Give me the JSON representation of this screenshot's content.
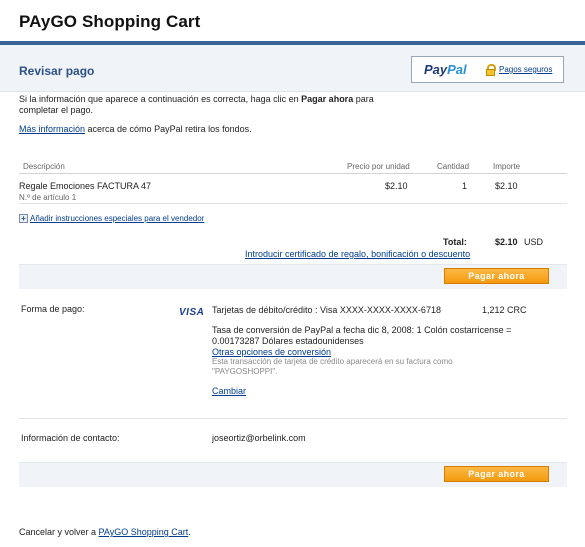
{
  "site_title": "PAyGO Shopping Cart",
  "review": {
    "title": "Revisar pago",
    "paypal_logo_part1": "Pay",
    "paypal_logo_part2": "Pal",
    "secure_link": "Pagos seguros"
  },
  "intro": {
    "text_before": "Si la información que aparece a continuación es correcta, haga clic en ",
    "text_bold": "Pagar ahora",
    "text_after": " para completar el pago.",
    "more_info_link": "Más información",
    "more_info_rest": " acerca de cómo PayPal retira los fondos."
  },
  "table": {
    "headers": {
      "description": "Descripción",
      "unit_price": "Precio por unidad",
      "quantity": "Cantidad",
      "amount": "Importe"
    },
    "items": [
      {
        "name": "Regale Emociones FACTURA 47",
        "item_number": "N.º de artículo 1",
        "unit_price": "$2.10",
        "quantity": "1",
        "amount": "$2.10"
      }
    ]
  },
  "vendor_instructions_link": "Añadir instrucciones especiales para el vendedor",
  "totals": {
    "label": "Total:",
    "value": "$2.10",
    "currency": "USD",
    "gift_link": "Introducir certificado de regalo, bonificación o descuento"
  },
  "pay_button_label": "Pagar ahora",
  "payment": {
    "label": "Forma de pago:",
    "card_brand": "VISA",
    "card_text": "Tarjetas de débito/crédito : Visa XXXX-XXXX-XXXX-6718",
    "card_amount": "1,212 CRC",
    "conversion_text": "Tasa de conversión de PayPal a fecha dic 8, 2008: 1 Colón costarricense = 0.00173287 Dólares estadounidenses",
    "conversion_link": "Otras opciones de conversión",
    "statement_note": "Esta transacción de tarjeta de crédito aparecerá en su factura como \"PAYGOSHOPPI\".",
    "change_link": "Cambiar"
  },
  "contact": {
    "label": "Información de contacto:",
    "email": "joseortiz@orbelink.com"
  },
  "cancel": {
    "text": "Cancelar y volver a ",
    "link": "PAyGO Shopping Cart",
    "period": "."
  },
  "colors": {
    "header_rule": "#3b6496",
    "title_blue": "#2d5187",
    "link": "#003c8f",
    "button_orange": "#f7a31c",
    "band_bg": "#f0f4f8"
  }
}
